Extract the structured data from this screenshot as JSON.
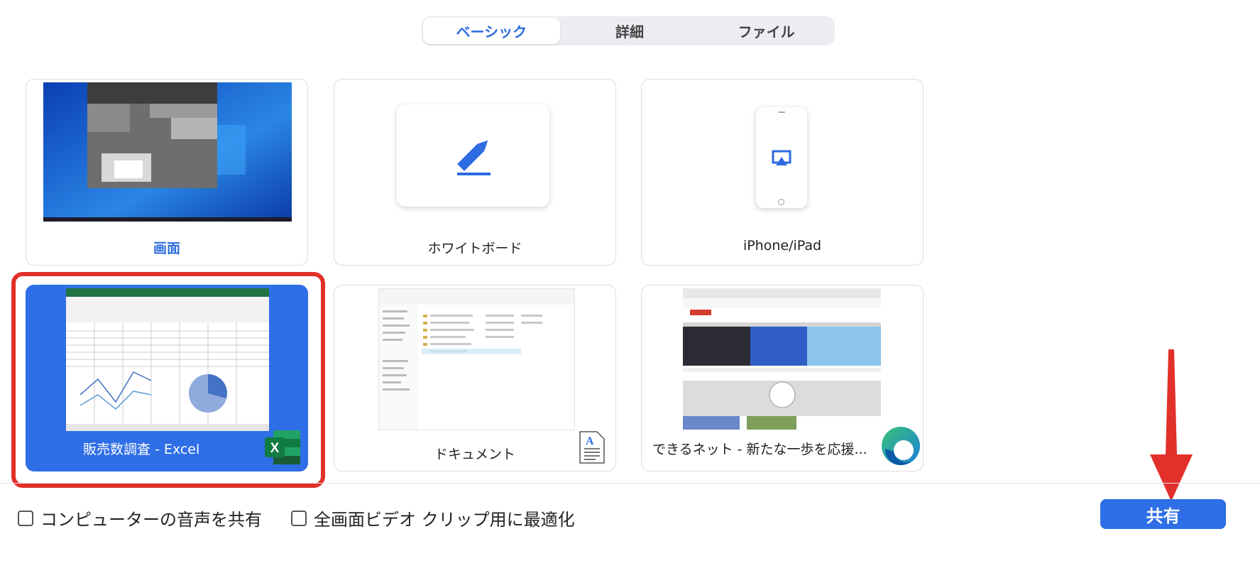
{
  "tabs": [
    {
      "label": "ベーシック",
      "active": true
    },
    {
      "label": "詳細",
      "active": false
    },
    {
      "label": "ファイル",
      "active": false
    }
  ],
  "cards": {
    "screen": {
      "label": "画面"
    },
    "whiteboard": {
      "label": "ホワイトボード",
      "icon": "pencil-icon"
    },
    "iphone": {
      "label": "iPhone/iPad",
      "icon": "airplay-icon"
    },
    "excel": {
      "label": "販売数調査 - Excel",
      "icon": "excel-icon",
      "selected": true
    },
    "document": {
      "label": "ドキュメント",
      "icon": "document-icon"
    },
    "browser": {
      "label": "できるネット - 新たな一歩を応援...",
      "icon": "edge-icon"
    }
  },
  "options": {
    "computer_audio": "コンピューターの音声を共有",
    "optimize_video": "全画面ビデオ クリップ用に最適化"
  },
  "share_button": "共有",
  "colors": {
    "accent": "#2e6ee6",
    "highlight_ring": "#e2302a",
    "arrow": "#e2302a"
  }
}
